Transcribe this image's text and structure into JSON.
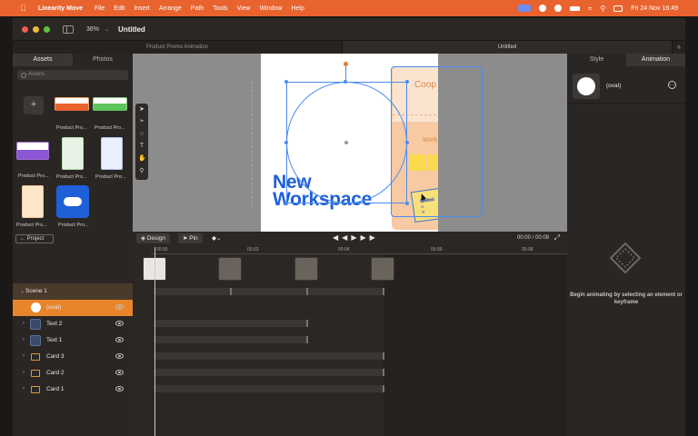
{
  "menubar": {
    "app_name": "Linearity Move",
    "menus": [
      "File",
      "Edit",
      "Insert",
      "Arrange",
      "Path",
      "Tools",
      "View",
      "Window",
      "Help"
    ],
    "datetime": "Fri 24 Nov  16:49",
    "accent": "#e8632e"
  },
  "window": {
    "zoom": "36%",
    "title": "Untitled"
  },
  "tabs": [
    {
      "label": "Product Promo Animation",
      "active": false
    },
    {
      "label": "Untitled",
      "active": true
    }
  ],
  "left_panel": {
    "tabs": [
      "Assets",
      "Photos"
    ],
    "search_placeholder": "Assets",
    "assets": [
      {
        "label": "Product Pro..."
      },
      {
        "label": "Product Pro..."
      },
      {
        "label": "Product Pro..."
      },
      {
        "label": "Product Pro..."
      },
      {
        "label": "Product Pro..."
      },
      {
        "label": "Product Pro..."
      },
      {
        "label": "Product Pro..."
      }
    ],
    "project_button": "Project"
  },
  "canvas": {
    "headline_line1": "New",
    "headline_line2": "Workspace",
    "card_title": "Coop",
    "card_label": "Work",
    "sticky_text_1": "Fix a w",
    "sticky_text_2": "Unified",
    "sticky_text_3": "special"
  },
  "timeline": {
    "design_label": "Design",
    "pin_label": "Pin",
    "time": "00:00 / 00:09",
    "ticks": [
      "00:00",
      "00:03",
      "00:04",
      "00:09",
      "00:08"
    ]
  },
  "layers": {
    "scene": "Scene 1",
    "items": [
      {
        "name": "(oval)",
        "kind": "oval",
        "selected": true
      },
      {
        "name": "Text 2",
        "kind": "text",
        "selected": false
      },
      {
        "name": "Text 1",
        "kind": "text",
        "selected": false
      },
      {
        "name": "Card 3",
        "kind": "group",
        "selected": false
      },
      {
        "name": "Card 2",
        "kind": "group",
        "selected": false
      },
      {
        "name": "Card 1",
        "kind": "group",
        "selected": false
      }
    ]
  },
  "right_panel": {
    "tabs": [
      "Style",
      "Animation"
    ],
    "selected_name": "(oval)",
    "hint": "Begin animating by selecting an element or keyframe"
  }
}
